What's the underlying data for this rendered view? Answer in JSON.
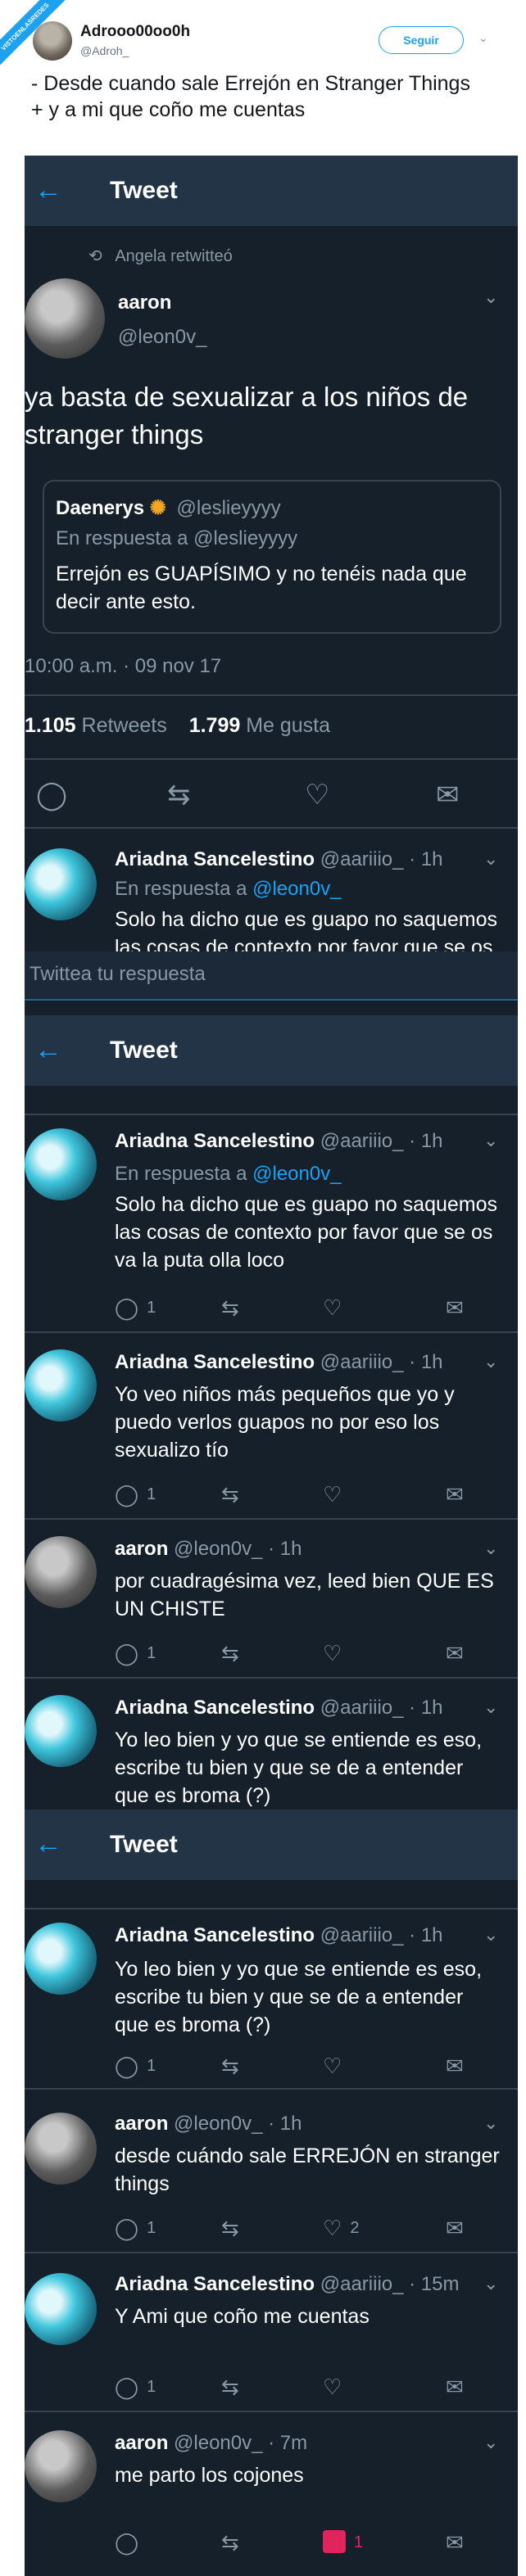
{
  "outer": {
    "ribbon": "VISTOENLASREDES",
    "name": "Adrooo00oo0h",
    "handle": "@Adroh_",
    "follow": "Seguir",
    "text": "- Desde cuando sale Errejón en Stranger Things\n+ y a mi que coño me cuentas"
  },
  "app": {
    "title": "Tweet",
    "compose": "Twittea tu respuesta"
  },
  "main_tweet": {
    "retweeted_by": "Angela retwitteó",
    "name": "aaron",
    "handle": "@leon0v_",
    "text": "ya basta de sexualizar a los niños de stranger things",
    "quote": {
      "name": "Daenerys",
      "handle": "@leslieyyyy",
      "reply_to_prefix": "En respuesta a",
      "reply_to": "@leslieyyyy",
      "text": "Errejón es GUAPÍSIMO y no tenéis nada que decir ante esto."
    },
    "timestamp": "10:00 a.m. · 09 nov 17",
    "retweets": "1.105",
    "retweets_label": "Retweets",
    "likes": "1.799",
    "likes_label": "Me gusta"
  },
  "replies": [
    {
      "name": "Ariadna Sancelestino",
      "meta": "@aariiio_ · 1h",
      "reply_prefix": "En respuesta a",
      "reply_to": "@leon0v_",
      "text": "Solo ha dicho que es guapo no saquemos las cosas de contexto por favor que se os va la puta olla loco",
      "replies": "1"
    },
    {
      "name": "Ariadna Sancelestino",
      "meta": "@aariiio_ · 1h",
      "text": "Yo veo niños más pequeños que yo y puedo verlos guapos no por eso los sexualizo tío",
      "replies": "1"
    },
    {
      "name": "aaron",
      "meta": "@leon0v_ · 1h",
      "text": "por cuadragésima vez, leed bien QUE ES UN CHISTE",
      "replies": "1"
    },
    {
      "name": "Ariadna Sancelestino",
      "meta": "@aariiio_ · 1h",
      "text": "Yo leo bien y yo que se entiende es eso, escribe tu bien y que se de a entender que es broma (?)",
      "replies": "1"
    },
    {
      "name": "aaron",
      "meta": "@leon0v_ · 1h",
      "text": "desde cuándo sale ERREJÓN en stranger things",
      "replies": "1",
      "likes": "2"
    },
    {
      "name": "Ariadna Sancelestino",
      "meta": "@aariiio_ · 15m",
      "text": "Y Ami que coño me cuentas",
      "replies": "1"
    },
    {
      "name": "aaron",
      "meta": "@leon0v_ · 7m",
      "text": "me parto los cojones",
      "likes": "1"
    }
  ],
  "icons": [
    "back-arrow-icon",
    "retweet-icon",
    "reply-icon",
    "heart-icon",
    "mail-icon",
    "chevron-down-icon"
  ],
  "colors": {
    "background": "#15202b",
    "header": "#243447",
    "accent": "#1da1f2",
    "muted": "#8899a6"
  }
}
